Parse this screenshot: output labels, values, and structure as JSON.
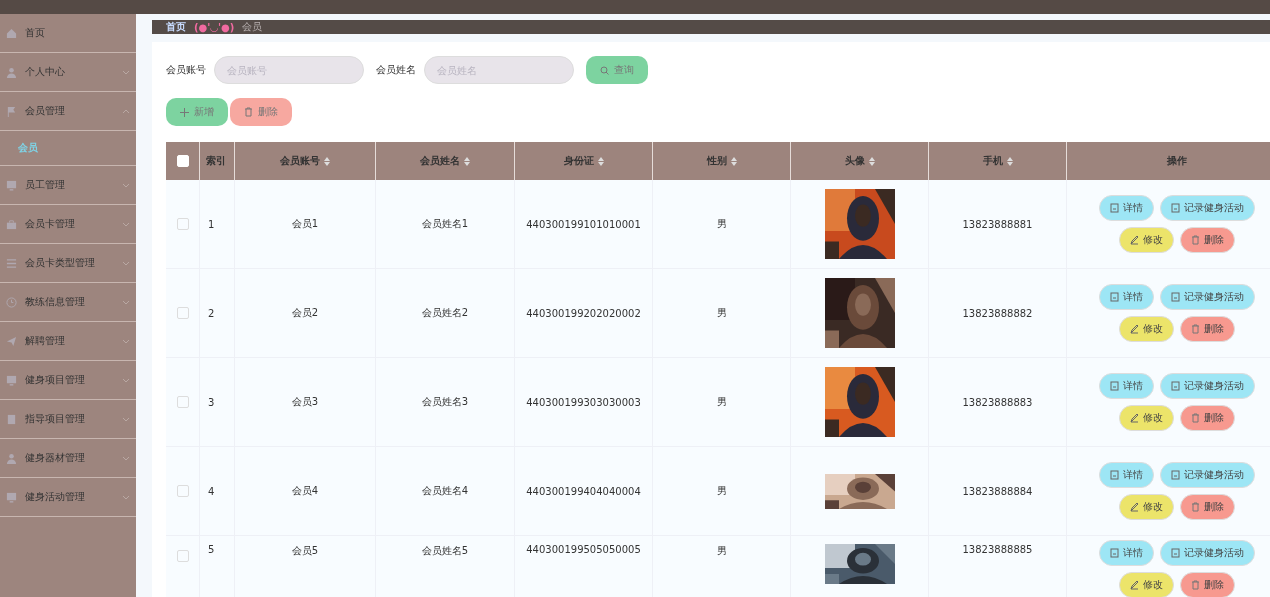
{
  "sidebar": {
    "items": [
      {
        "label": "首页"
      },
      {
        "label": "个人中心",
        "expanded": false
      },
      {
        "label": "会员管理",
        "expanded": true,
        "children": [
          {
            "label": "会员",
            "selected": true
          }
        ]
      },
      {
        "label": "员工管理",
        "expanded": false
      },
      {
        "label": "会员卡管理",
        "expanded": false
      },
      {
        "label": "会员卡类型管理",
        "expanded": false
      },
      {
        "label": "教练信息管理",
        "expanded": false
      },
      {
        "label": "解聘管理",
        "expanded": false
      },
      {
        "label": "健身项目管理",
        "expanded": false
      },
      {
        "label": "指导项目管理",
        "expanded": false
      },
      {
        "label": "健身器材管理",
        "expanded": false
      },
      {
        "label": "健身活动管理",
        "expanded": false
      }
    ]
  },
  "breadcrumb": {
    "home": "首页",
    "emoticon": "(●'◡'●)",
    "current": "会员"
  },
  "search": {
    "fields": [
      {
        "label": "会员账号",
        "placeholder": "会员账号"
      },
      {
        "label": "会员姓名",
        "placeholder": "会员姓名"
      }
    ],
    "button": "查询"
  },
  "actions": [
    {
      "kind": "add",
      "label": "新增"
    },
    {
      "kind": "delete",
      "label": "删除"
    }
  ],
  "table": {
    "select_all": {
      "checked": false
    },
    "columns": [
      {
        "label": "索引",
        "sortable": false
      },
      {
        "label": "会员账号",
        "sortable": true
      },
      {
        "label": "会员姓名",
        "sortable": true
      },
      {
        "label": "身份证",
        "sortable": true
      },
      {
        "label": "性别",
        "sortable": true
      },
      {
        "label": "头像",
        "sortable": true
      },
      {
        "label": "手机",
        "sortable": true
      },
      {
        "label": "操作",
        "sortable": false
      }
    ],
    "rows": [
      {
        "checked": false,
        "index": "1",
        "account": "会员1",
        "name": "会员姓名1",
        "id_card": "440300199101010001",
        "gender": "男",
        "avatar": {
          "kind": "picture"
        },
        "phone": "13823888881",
        "buttons": [
          {
            "kind": "detail",
            "label": "详情"
          },
          {
            "kind": "record",
            "label": "记录健身活动"
          },
          {
            "kind": "edit",
            "label": "修改"
          },
          {
            "kind": "delete",
            "label": "删除"
          }
        ]
      },
      {
        "checked": false,
        "index": "2",
        "account": "会员2",
        "name": "会员姓名2",
        "id_card": "440300199202020002",
        "gender": "男",
        "avatar": {
          "kind": "picture"
        },
        "phone": "13823888882",
        "buttons": [
          {
            "kind": "detail",
            "label": "详情"
          },
          {
            "kind": "record",
            "label": "记录健身活动"
          },
          {
            "kind": "edit",
            "label": "修改"
          },
          {
            "kind": "delete",
            "label": "删除"
          }
        ]
      },
      {
        "checked": false,
        "index": "3",
        "account": "会员3",
        "name": "会员姓名3",
        "id_card": "440300199303030003",
        "gender": "男",
        "avatar": {
          "kind": "picture"
        },
        "phone": "13823888883",
        "buttons": [
          {
            "kind": "detail",
            "label": "详情"
          },
          {
            "kind": "record",
            "label": "记录健身活动"
          },
          {
            "kind": "edit",
            "label": "修改"
          },
          {
            "kind": "delete",
            "label": "删除"
          }
        ]
      },
      {
        "checked": false,
        "index": "4",
        "account": "会员4",
        "name": "会员姓名4",
        "id_card": "440300199404040004",
        "gender": "男",
        "avatar": {
          "kind": "picture"
        },
        "phone": "13823888884",
        "buttons": [
          {
            "kind": "detail",
            "label": "详情"
          },
          {
            "kind": "record",
            "label": "记录健身活动"
          },
          {
            "kind": "edit",
            "label": "修改"
          },
          {
            "kind": "delete",
            "label": "删除"
          }
        ]
      },
      {
        "checked": false,
        "index": "5",
        "account": "会员5",
        "name": "会员姓名5",
        "id_card": "440300199505050005",
        "gender": "男",
        "avatar": {
          "kind": "picture"
        },
        "phone": "13823888885",
        "buttons": [
          {
            "kind": "detail",
            "label": "详情"
          },
          {
            "kind": "record",
            "label": "记录健身活动"
          },
          {
            "kind": "edit",
            "label": "修改"
          },
          {
            "kind": "delete",
            "label": "删除"
          }
        ]
      }
    ]
  }
}
